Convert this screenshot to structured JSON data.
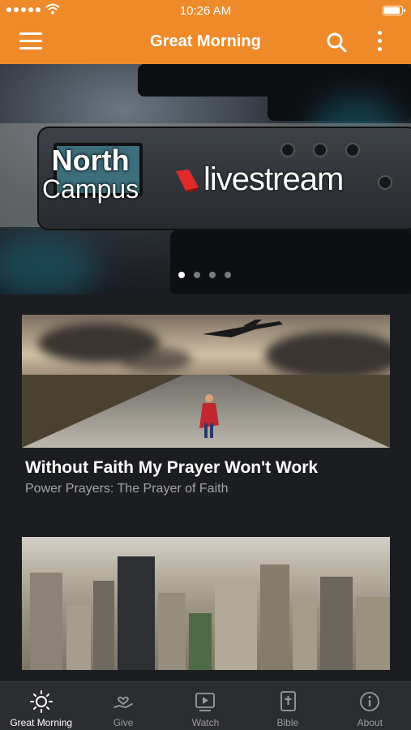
{
  "status_bar": {
    "time": "10:26 AM"
  },
  "nav": {
    "title": "Great Morning",
    "menu_icon": "hamburger-menu-icon",
    "search_icon": "search-icon",
    "more_icon": "more-vertical-icon"
  },
  "hero": {
    "campus_line1": "North",
    "campus_line2": "Campus",
    "brand": "livestream",
    "slides_total": 4,
    "active_slide": 1
  },
  "cards": [
    {
      "title": "Without Faith My Prayer Won't Work",
      "subtitle": "Power Prayers: The Prayer of Faith"
    },
    {
      "title": "",
      "subtitle": ""
    }
  ],
  "tabs": [
    {
      "label": "Great Morning",
      "icon": "sun-icon",
      "active": true
    },
    {
      "label": "Give",
      "icon": "give-hand-icon",
      "active": false
    },
    {
      "label": "Watch",
      "icon": "video-play-icon",
      "active": false
    },
    {
      "label": "Bible",
      "icon": "bible-cross-icon",
      "active": false
    },
    {
      "label": "About",
      "icon": "info-icon",
      "active": false
    }
  ],
  "colors": {
    "accent": "#ef8a2a",
    "background": "#1c1d21",
    "tabbar": "#2c2d31"
  }
}
